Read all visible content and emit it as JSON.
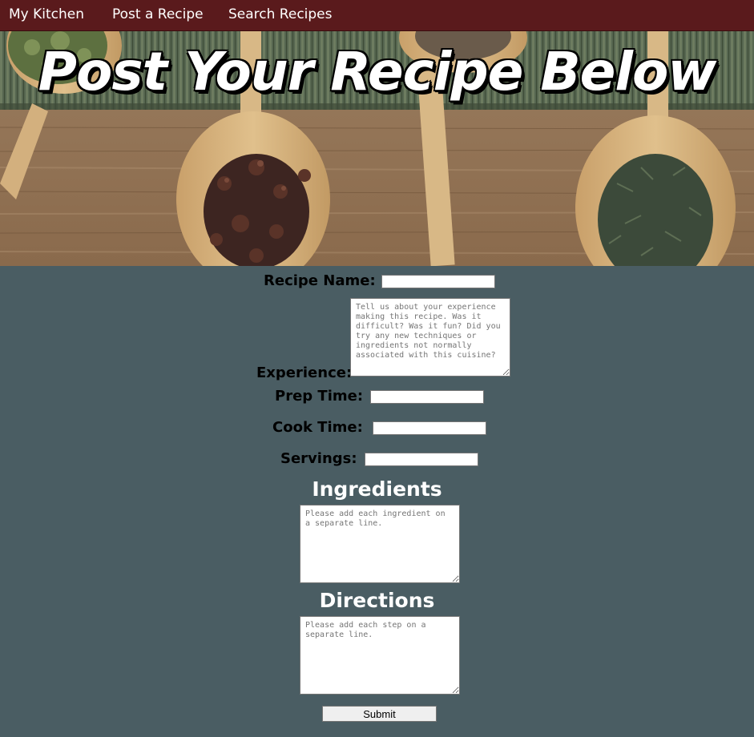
{
  "nav": {
    "items": [
      {
        "label": "My Kitchen"
      },
      {
        "label": "Post a Recipe"
      },
      {
        "label": "Search Recipes"
      }
    ],
    "background_color": "#5a1a1c"
  },
  "hero": {
    "title": "Post Your Recipe Below"
  },
  "form": {
    "recipe_name": {
      "label": "Recipe Name:",
      "value": ""
    },
    "experience": {
      "label": "Experience:",
      "placeholder": "Tell us about your experience making this recipe. Was it difficult? Was it fun? Did you try any new techniques or ingredients not normally associated with this cuisine?"
    },
    "prep_time": {
      "label": "Prep Time:",
      "value": ""
    },
    "cook_time": {
      "label": "Cook Time:",
      "value": ""
    },
    "servings": {
      "label": "Servings:",
      "value": ""
    },
    "ingredients": {
      "heading": "Ingredients",
      "placeholder": "Please add each ingredient on a separate line."
    },
    "directions": {
      "heading": "Directions",
      "placeholder": "Please add each step on a separate line."
    },
    "submit_label": "Submit"
  },
  "colors": {
    "page_background": "#4a5d63",
    "heading_text": "#ffffff"
  }
}
